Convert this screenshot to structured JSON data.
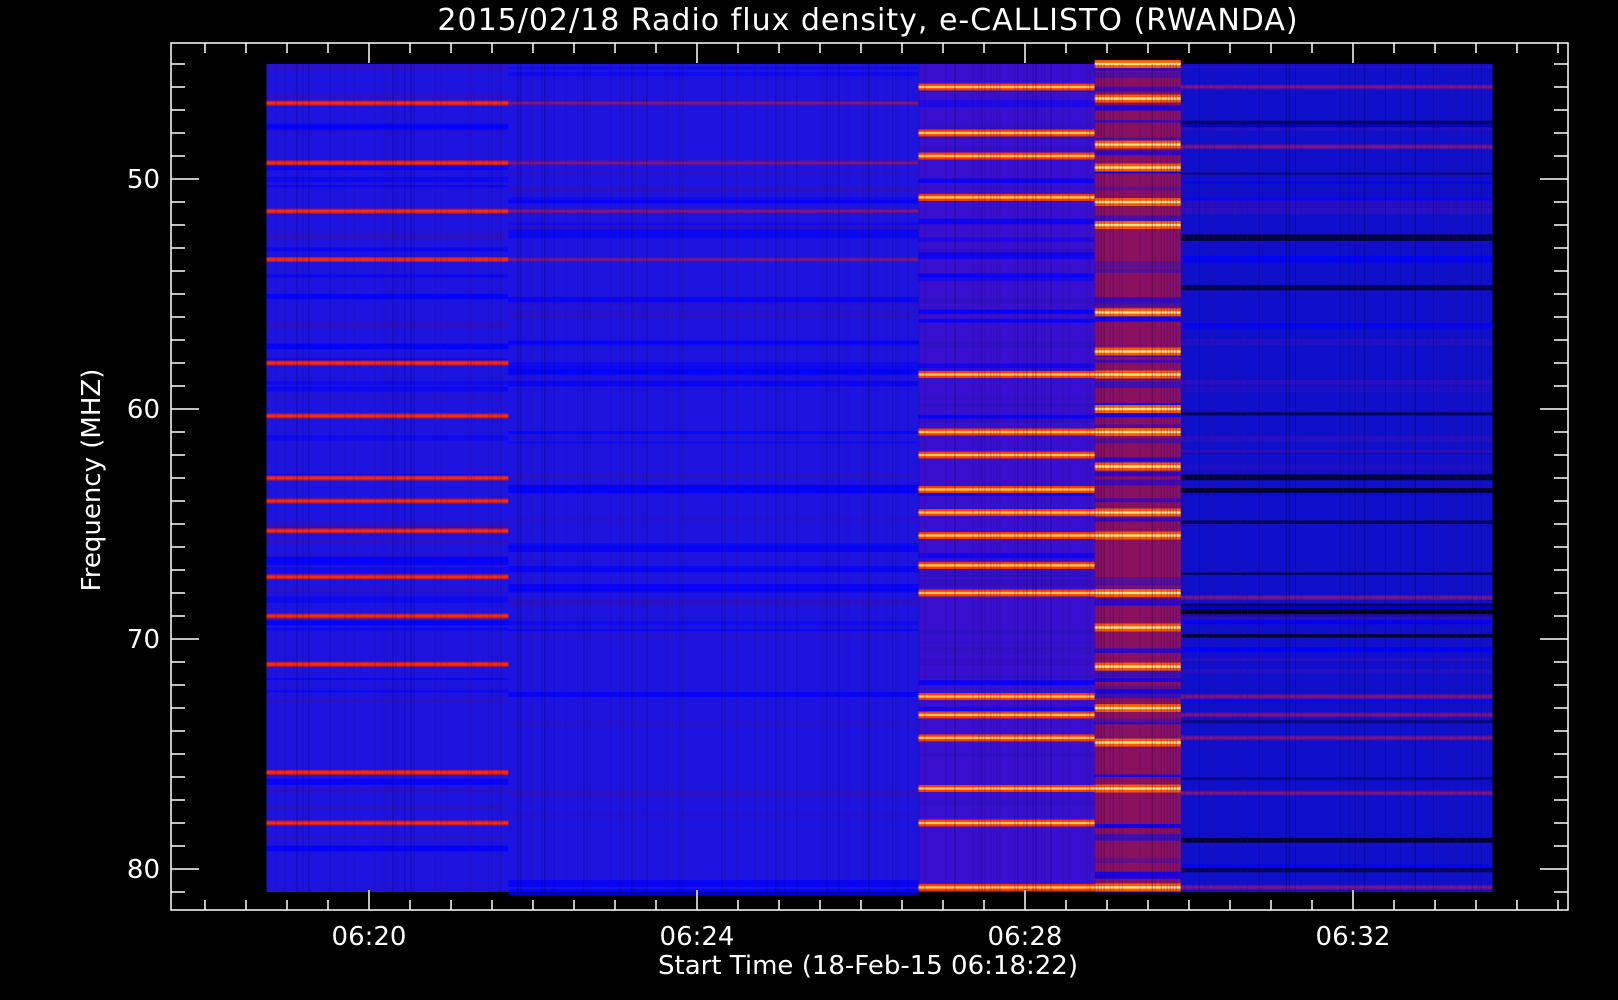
{
  "chart_data": {
    "type": "heatmap",
    "title": "2015/02/18  Radio flux density, e-CALLISTO (RWANDA)",
    "xlabel": "Start Time (18-Feb-15 06:18:22)",
    "ylabel": "Frequency (MHZ)",
    "x_ticks": [
      "06:20",
      "06:24",
      "06:28",
      "06:32"
    ],
    "x_tick_minutes": [
      20,
      24,
      28,
      32
    ],
    "y_ticks": [
      50,
      60,
      70,
      80
    ],
    "xlim_minutes": [
      18.0,
      34.5
    ],
    "ylim": [
      80.5,
      45.0
    ],
    "data_extent": {
      "time_start_minutes": 18.75,
      "time_end_minutes": 33.7,
      "freq_top": 45.0,
      "freq_bottom": 81.0
    },
    "colormap": [
      "#000000",
      "#0000ff",
      "#ff0000",
      "#ffff00",
      "#ffffff"
    ],
    "segments": [
      {
        "t_start": 18.75,
        "t_end": 21.7,
        "level": "medium",
        "strong_bands": [
          46.7,
          49.3,
          51.4,
          53.5,
          58.0,
          60.3,
          63.0,
          64.0,
          65.3,
          67.3,
          69.0,
          71.1,
          75.8,
          78.0
        ]
      },
      {
        "t_start": 21.7,
        "t_end": 26.7,
        "level": "low",
        "strong_bands": [
          46.7,
          49.3,
          51.4,
          53.5
        ]
      },
      {
        "t_start": 26.7,
        "t_end": 28.85,
        "level": "high",
        "strong_bands": [
          46.0,
          48.0,
          49.0,
          50.8,
          58.5,
          61.0,
          62.0,
          63.5,
          64.5,
          65.5,
          66.8,
          68.0,
          72.5,
          73.3,
          74.3,
          76.5,
          78.0,
          80.8
        ]
      },
      {
        "t_start": 28.85,
        "t_end": 29.9,
        "level": "very-high",
        "strong_bands": [
          45.0,
          46.5,
          48.5,
          49.5,
          51.0,
          52.0,
          55.8,
          57.5,
          58.5,
          60.0,
          61.0,
          62.5,
          64.5,
          65.5,
          68.0,
          69.5,
          71.2,
          73.0,
          74.5,
          76.5,
          80.8
        ]
      },
      {
        "t_start": 29.9,
        "t_end": 33.7,
        "level": "low",
        "strong_bands": [
          46.0,
          48.6,
          68.2,
          72.5,
          73.3,
          74.3,
          76.7,
          80.8
        ]
      }
    ]
  }
}
